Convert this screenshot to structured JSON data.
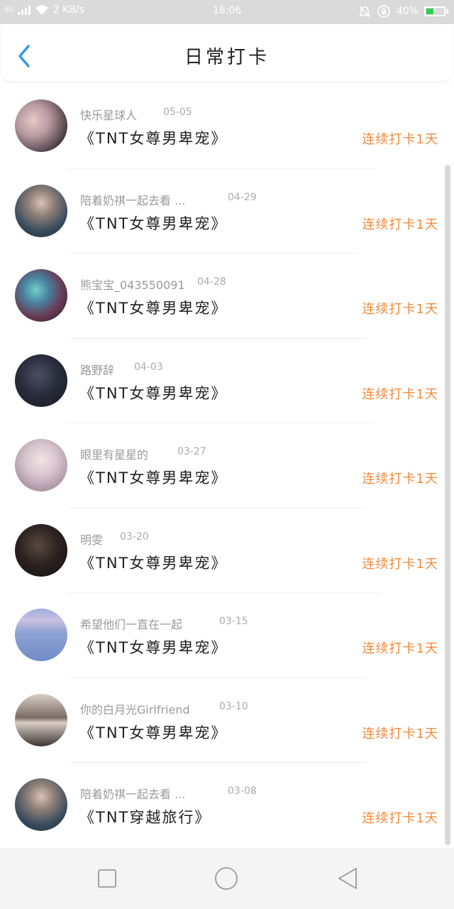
{
  "status_bar": {
    "network": "4G",
    "speed": "2 KB/s",
    "time": "18:06",
    "battery": "40%",
    "icons": [
      "signal-icon",
      "wifi-icon",
      "bell-muted-icon",
      "rotation-lock-icon",
      "battery-charging-icon"
    ]
  },
  "header": {
    "title": "日常打卡",
    "back_icon": "chevron-left-icon"
  },
  "entries": [
    {
      "name": "快乐星球人",
      "date": "05-05",
      "book": "《TNT女尊男卑宠》",
      "streak": "连续打卡1天"
    },
    {
      "name": "陪着奶祺一起去看 ...",
      "date": "04-29",
      "book": "《TNT女尊男卑宠》",
      "streak": "连续打卡1天"
    },
    {
      "name": "熊宝宝_043550091",
      "date": "04-28",
      "book": "《TNT女尊男卑宠》",
      "streak": "连续打卡1天"
    },
    {
      "name": "路野辞",
      "date": "04-03",
      "book": "《TNT女尊男卑宠》",
      "streak": "连续打卡1天"
    },
    {
      "name": "眼里有星星的",
      "date": "03-27",
      "book": "《TNT女尊男卑宠》",
      "streak": "连续打卡1天"
    },
    {
      "name": "明雯",
      "date": "03-20",
      "book": "《TNT女尊男卑宠》",
      "streak": "连续打卡1天"
    },
    {
      "name": "希望他们一直在一起",
      "date": "03-15",
      "book": "《TNT女尊男卑宠》",
      "streak": "连续打卡1天"
    },
    {
      "name": "你的白月光Girlfriend",
      "date": "03-10",
      "book": "《TNT女尊男卑宠》",
      "streak": "连续打卡1天"
    },
    {
      "name": "陪着奶祺一起去看 ...",
      "date": "03-08",
      "book": "《TNT穿越旅行》",
      "streak": "连续打卡1天"
    }
  ],
  "colors": {
    "accent_blue": "#2e9bf0",
    "streak_orange": "#f08a3c",
    "status_bar_bg": "#dadada",
    "nav_bar_bg": "#f4f4f4"
  },
  "nav_bar": {
    "icons": [
      "recent-apps-icon",
      "home-icon",
      "back-triangle-icon"
    ]
  }
}
